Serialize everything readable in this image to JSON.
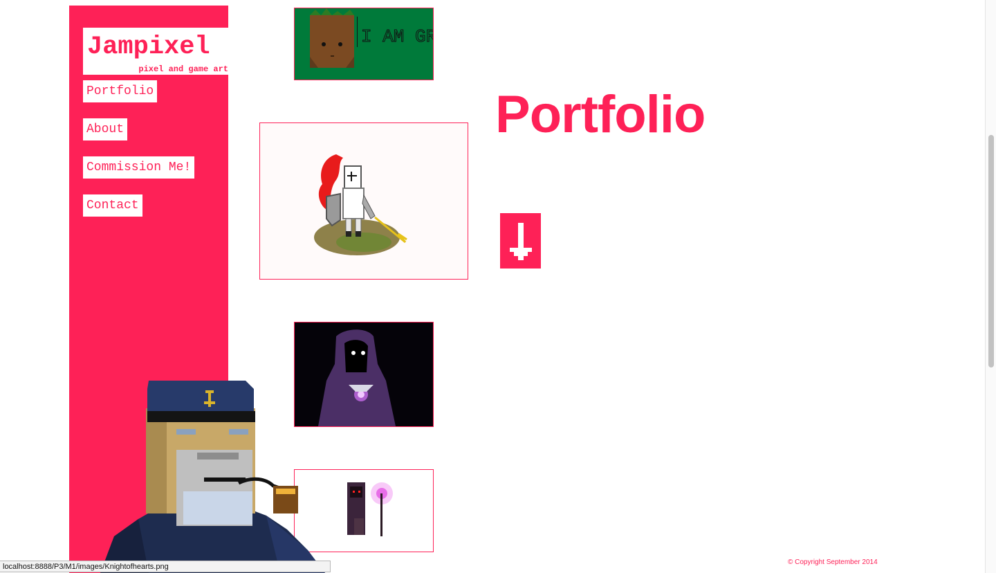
{
  "site": {
    "title": "Jampixel",
    "tagline": "pixel and game art"
  },
  "nav": {
    "items": [
      {
        "label": "Portfolio"
      },
      {
        "label": "About"
      },
      {
        "label": "Commission Me!"
      },
      {
        "label": "Contact"
      }
    ]
  },
  "main": {
    "heading": "Portfolio"
  },
  "gallery": {
    "groot_caption": "I AM GROOT"
  },
  "footer": {
    "copyright": "© Copyright September 2014"
  },
  "statusbar": {
    "url": "localhost:8888/P3/M1/images/Knightofhearts.png"
  },
  "colors": {
    "accent": "#fe2157",
    "background": "#ffffff"
  },
  "icons": {
    "scroll_down": "down-arrow-icon"
  }
}
